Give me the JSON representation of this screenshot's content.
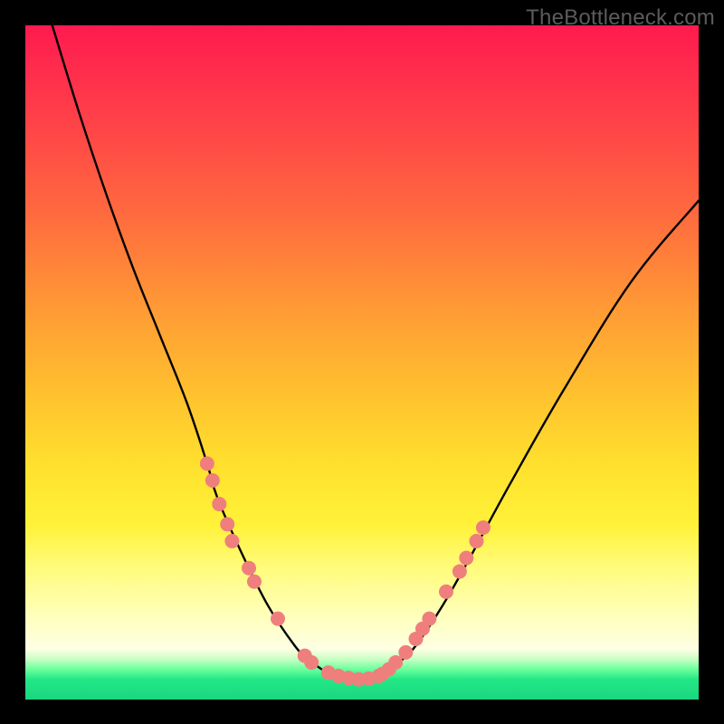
{
  "watermark": "TheBottleneck.com",
  "chart_data": {
    "type": "line",
    "title": "",
    "xlabel": "",
    "ylabel": "",
    "xlim": [
      0,
      100
    ],
    "ylim": [
      0,
      100
    ],
    "grid": false,
    "legend": false,
    "series": [
      {
        "name": "bottleneck-curve",
        "x": [
          4,
          8,
          12,
          16,
          20,
          24,
          27,
          28.5,
          32,
          36,
          40,
          42,
          44,
          46,
          48,
          50,
          52,
          54,
          55.5,
          58,
          62,
          66,
          72,
          80,
          90,
          100
        ],
        "y": [
          100,
          87,
          75,
          64,
          54,
          44,
          35,
          30,
          22,
          14,
          8,
          6,
          4.5,
          3.5,
          3,
          3,
          3.3,
          4.2,
          5.5,
          8,
          14,
          21,
          32,
          46,
          62,
          74
        ]
      }
    ],
    "markers": {
      "name": "highlight-dots",
      "color": "#ef7f7c",
      "radius_px": 8,
      "points_xy": [
        [
          27.0,
          35.0
        ],
        [
          27.8,
          32.5
        ],
        [
          28.8,
          29.0
        ],
        [
          30.0,
          26.0
        ],
        [
          30.7,
          23.5
        ],
        [
          33.2,
          19.5
        ],
        [
          34.0,
          17.5
        ],
        [
          37.5,
          12.0
        ],
        [
          41.5,
          6.5
        ],
        [
          42.5,
          5.5
        ],
        [
          45.0,
          4.0
        ],
        [
          46.5,
          3.5
        ],
        [
          48.0,
          3.2
        ],
        [
          49.5,
          3.0
        ],
        [
          51.0,
          3.1
        ],
        [
          52.5,
          3.5
        ],
        [
          53.0,
          3.8
        ],
        [
          54.0,
          4.5
        ],
        [
          55.0,
          5.5
        ],
        [
          56.5,
          7.0
        ],
        [
          58.0,
          9.0
        ],
        [
          59.0,
          10.5
        ],
        [
          60.0,
          12.0
        ],
        [
          62.5,
          16.0
        ],
        [
          64.5,
          19.0
        ],
        [
          65.5,
          21.0
        ],
        [
          67.0,
          23.5
        ],
        [
          68.0,
          25.5
        ]
      ]
    }
  }
}
